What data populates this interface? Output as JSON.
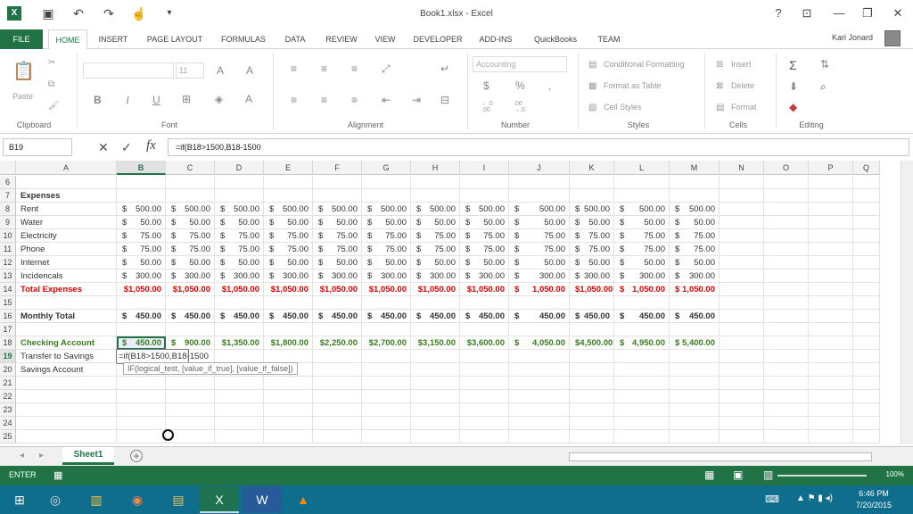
{
  "window": {
    "title": "Book1.xlsx - Excel",
    "app_icon": "excel-icon"
  },
  "tabs": [
    "FILE",
    "HOME",
    "INSERT",
    "PAGE LAYOUT",
    "FORMULAS",
    "DATA",
    "REVIEW",
    "VIEW",
    "DEVELOPER",
    "ADD-INS",
    "QuickBooks",
    "TEAM"
  ],
  "active_tab": "HOME",
  "user": {
    "name": "Kari Jonard"
  },
  "ribbon": {
    "clipboard": {
      "label": "Clipboard",
      "paste": "Paste"
    },
    "font": {
      "label": "Font",
      "size": "11",
      "bold": "B",
      "italic": "I",
      "underline": "U"
    },
    "alignment": {
      "label": "Alignment"
    },
    "number": {
      "label": "Number",
      "format": "Accounting",
      "currency": "$",
      "percent": "%",
      "comma": ",",
      "inc_decimal": "←.0 .00",
      "dec_decimal": ".00 →.0"
    },
    "styles": {
      "label": "Styles",
      "conditional": "Conditional Formatting",
      "table": "Format as Table",
      "cell_styles": "Cell Styles"
    },
    "cells": {
      "label": "Cells",
      "insert": "Insert",
      "delete": "Delete",
      "format": "Format"
    },
    "editing": {
      "label": "Editing"
    }
  },
  "formula_bar": {
    "name_box": "B19",
    "formula": "=if(B18>1500,B18-1500",
    "cancel": "✕",
    "enter": "✓",
    "fx": "fx"
  },
  "columns": [
    "A",
    "B",
    "C",
    "D",
    "E",
    "F",
    "G",
    "H",
    "I",
    "J",
    "K",
    "L",
    "M",
    "N",
    "O",
    "P",
    "Q"
  ],
  "selected_column": "B",
  "rows": [
    {
      "num": "6",
      "label": "",
      "style": "",
      "values": []
    },
    {
      "num": "7",
      "label": "Expenses",
      "style": "bold",
      "values": []
    },
    {
      "num": "8",
      "label": "Rent",
      "style": "",
      "values": [
        "500.00",
        "500.00",
        "500.00",
        "500.00",
        "500.00",
        "500.00",
        "500.00",
        "500.00",
        "500.00",
        "500.00",
        "500.00",
        "500.00"
      ]
    },
    {
      "num": "9",
      "label": "Water",
      "style": "",
      "values": [
        "50.00",
        "50.00",
        "50.00",
        "50.00",
        "50.00",
        "50.00",
        "50.00",
        "50.00",
        "50.00",
        "50.00",
        "50.00",
        "50.00"
      ]
    },
    {
      "num": "10",
      "label": "Electricity",
      "style": "",
      "values": [
        "75.00",
        "75.00",
        "75.00",
        "75.00",
        "75.00",
        "75.00",
        "75.00",
        "75.00",
        "75.00",
        "75.00",
        "75.00",
        "75.00"
      ]
    },
    {
      "num": "11",
      "label": "Phone",
      "style": "",
      "values": [
        "75.00",
        "75.00",
        "75.00",
        "75.00",
        "75.00",
        "75.00",
        "75.00",
        "75.00",
        "75.00",
        "75.00",
        "75.00",
        "75.00"
      ]
    },
    {
      "num": "12",
      "label": "Internet",
      "style": "",
      "values": [
        "50.00",
        "50.00",
        "50.00",
        "50.00",
        "50.00",
        "50.00",
        "50.00",
        "50.00",
        "50.00",
        "50.00",
        "50.00",
        "50.00"
      ]
    },
    {
      "num": "13",
      "label": "Incidencals",
      "style": "",
      "values": [
        "300.00",
        "300.00",
        "300.00",
        "300.00",
        "300.00",
        "300.00",
        "300.00",
        "300.00",
        "300.00",
        "300.00",
        "300.00",
        "300.00"
      ]
    },
    {
      "num": "14",
      "label": "Total Expenses",
      "style": "red",
      "values": [
        "$1,050.00",
        "$1,050.00",
        "$1,050.00",
        "$1,050.00",
        "$1,050.00",
        "$1,050.00",
        "$1,050.00",
        "$1,050.00",
        "1,050.00",
        "$1,050.00",
        "1,050.00",
        "1,050.00"
      ]
    },
    {
      "num": "15",
      "label": "",
      "style": "",
      "values": []
    },
    {
      "num": "16",
      "label": "Monthly Total",
      "style": "bold",
      "values": [
        "450.00",
        "450.00",
        "450.00",
        "450.00",
        "450.00",
        "450.00",
        "450.00",
        "450.00",
        "450.00",
        "450.00",
        "450.00",
        "450.00"
      ]
    },
    {
      "num": "17",
      "label": "",
      "style": "",
      "values": []
    },
    {
      "num": "18",
      "label": "Checking Account",
      "style": "green-bold",
      "values": [
        "450.00",
        "900.00",
        "$1,350.00",
        "$1,800.00",
        "$2,250.00",
        "$2,700.00",
        "$3,150.00",
        "$3,600.00",
        "4,050.00",
        "$4,500.00",
        "4,950.00",
        "5,400.00"
      ]
    },
    {
      "num": "19",
      "label": "Transfer to Savings",
      "style": "",
      "values": []
    },
    {
      "num": "20",
      "label": "Savings Account",
      "style": "",
      "values": []
    },
    {
      "num": "21",
      "label": "",
      "style": "",
      "values": []
    },
    {
      "num": "22",
      "label": "",
      "style": "",
      "values": []
    },
    {
      "num": "23",
      "label": "",
      "style": "",
      "values": []
    },
    {
      "num": "24",
      "label": "",
      "style": "",
      "values": []
    },
    {
      "num": "25",
      "label": "",
      "style": "",
      "values": []
    }
  ],
  "editing_cell": {
    "address": "B19",
    "text": "=if(B18>1500,B18-1500",
    "tooltip": "IF(logical_test, [value_if_true], [value_if_false])"
  },
  "sheet_tabs": [
    "Sheet1"
  ],
  "status": {
    "mode": "ENTER",
    "zoom": "100%"
  },
  "taskbar": {
    "time": "6:46 PM",
    "date": "7/20/2015",
    "apps": [
      "windows-start-icon",
      "satellite-icon",
      "file-explorer-icon",
      "chrome-icon",
      "folder-icon",
      "excel-icon",
      "word-icon",
      "vlc-icon"
    ]
  }
}
